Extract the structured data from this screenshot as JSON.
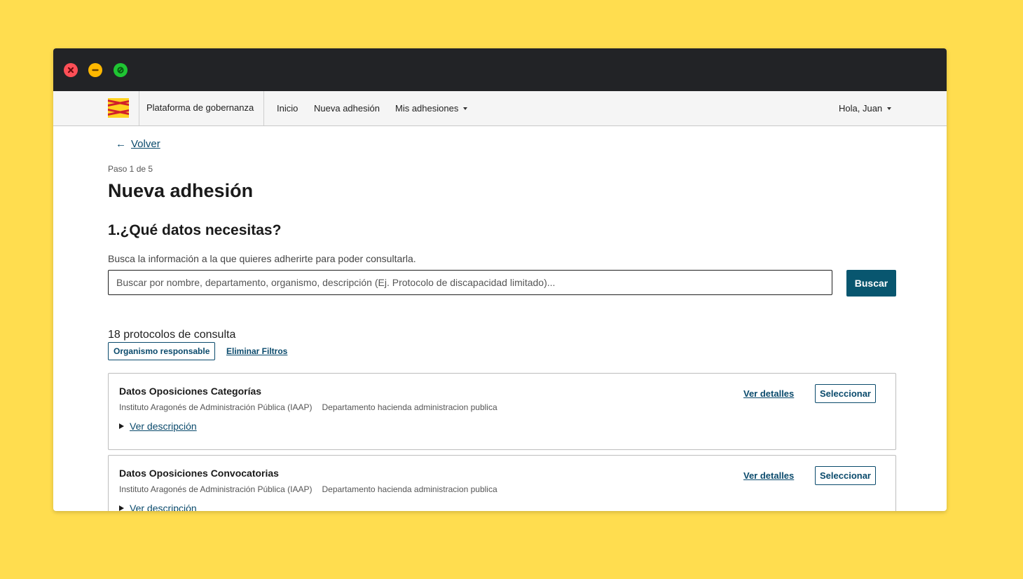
{
  "colors": {
    "background": "#FFDD4F",
    "titlebar": "#222326",
    "primary": "#08566f",
    "link": "#0a4a6c"
  },
  "window_controls": {
    "close_icon": "close-icon",
    "minimize_icon": "minimize-icon",
    "maximize_icon": "maximize-icon"
  },
  "navbar": {
    "logo_icon": "aragon-flag-logo",
    "brand": "Plataforma de gobernanza",
    "items": [
      {
        "label": "Inicio"
      },
      {
        "label": "Nueva adhesión"
      },
      {
        "label": "Mis adhesiones"
      }
    ],
    "user_menu": "Hola, Juan"
  },
  "page": {
    "back_label": "Volver",
    "step": "Paso 1 de 5",
    "title": "Nueva adhesión",
    "section_title": "1.¿Qué datos necesitas?",
    "intro": "Busca la información a la que quieres adherirte para poder consultarla."
  },
  "search": {
    "placeholder": "Buscar por nombre, departamento, organismo, descripción (Ej. Protocolo de discapacidad limitado)...",
    "value": "",
    "button_label": "Buscar"
  },
  "results": {
    "count_text": "18 protocolos de consulta",
    "filter_chip": "Organismo responsable",
    "clear_filters": "Eliminar Filtros",
    "items": [
      {
        "title": "Datos Oposiciones Categorías",
        "organism": "Instituto Aragonés de Administración Pública (IAAP)",
        "department": "Departamento hacienda administracion publica",
        "description_toggle": "Ver descripción",
        "details_label": "Ver detalles",
        "select_label": "Seleccionar"
      },
      {
        "title": "Datos Oposiciones Convocatorias",
        "organism": "Instituto Aragonés de Administración Pública (IAAP)",
        "department": "Departamento hacienda administracion publica",
        "description_toggle": "Ver descripción",
        "details_label": "Ver detalles",
        "select_label": "Seleccionar"
      }
    ]
  }
}
